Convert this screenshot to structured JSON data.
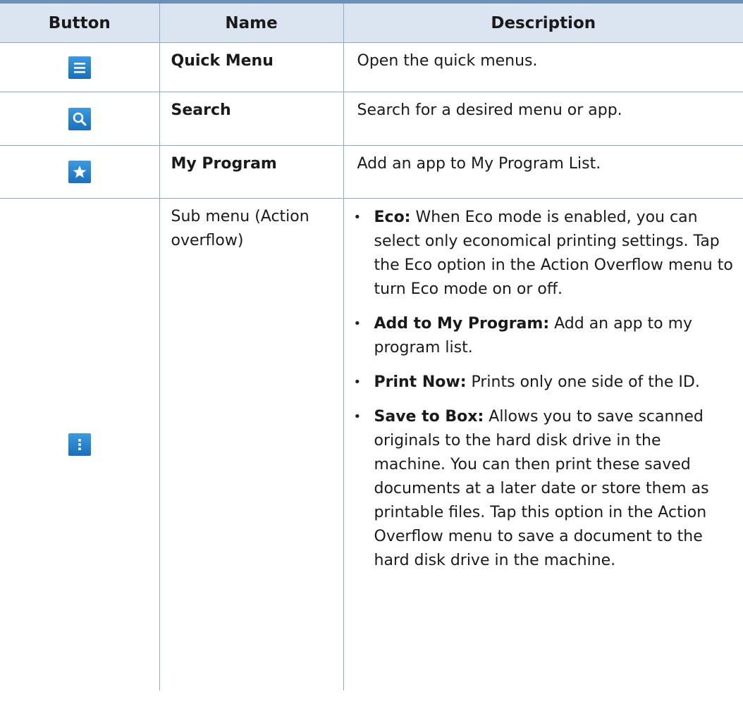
{
  "table": {
    "headers": {
      "button": "Button",
      "name": "Name",
      "description": "Description"
    },
    "rows": [
      {
        "icon": "hamburger-menu-icon",
        "name": "Quick Menu",
        "description": "Open the quick menus."
      },
      {
        "icon": "search-icon",
        "name": "Search",
        "description": "Search for a desired menu or app."
      },
      {
        "icon": "star-icon",
        "name": "My Program",
        "description": "Add an app to My Program List."
      },
      {
        "icon": "vertical-dots-icon",
        "name": "Sub menu (Action overflow)",
        "items": [
          {
            "term": "Eco:",
            "text": " When Eco mode is enabled, you can select only economical printing settings. Tap the Eco option in the Action Overflow menu to turn Eco mode on or off."
          },
          {
            "term": "Add to My Program:",
            "text": " Add an app to my program list."
          },
          {
            "term": "Print Now:",
            "text": " Prints only one side of the ID."
          },
          {
            "term": "Save to Box:",
            "text": " Allows you to save scanned originals to the hard disk drive in the machine. You can then print these saved documents at a later date or store them as printable files. Tap this option in the Action Overflow menu to save a document to the hard disk drive in the machine."
          }
        ]
      }
    ]
  },
  "colors": {
    "header_bg": "#dbe5f1",
    "border": "#8eaac8",
    "icon_blue": "#1a6fbd"
  }
}
